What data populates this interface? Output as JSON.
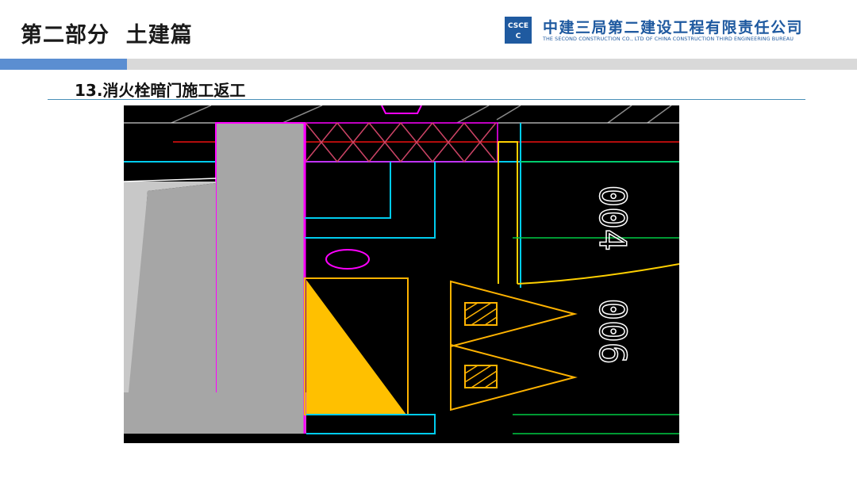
{
  "header": {
    "section_title": "第二部分  土建篇",
    "company_name": "中建三局第二建设工程有限责任公司",
    "company_name_en": "THE SECOND CONSTRUCTION CO., LTD OF CHINA CONSTRUCTION THIRD ENGINEERING BUREAU",
    "logo_text": "CSCEC"
  },
  "slide": {
    "heading": "13.消火栓暗门施工返工"
  },
  "diagram": {
    "dimension_top": "004",
    "dimension_bottom": "006"
  },
  "colors": {
    "accent_blue": "#5b8ed1",
    "band_gray": "#d9d9d9",
    "brand_blue": "#1f5aa0",
    "cad_bg": "#000000",
    "wall_gray": "#a6a6a6",
    "door_fill": "#ffc000",
    "line_magenta": "#ff00ff",
    "line_cyan": "#00ccee",
    "line_green": "#00cc44",
    "line_red": "#ee1111",
    "line_yellow": "#ffd000",
    "line_orange": "#ffb300"
  }
}
